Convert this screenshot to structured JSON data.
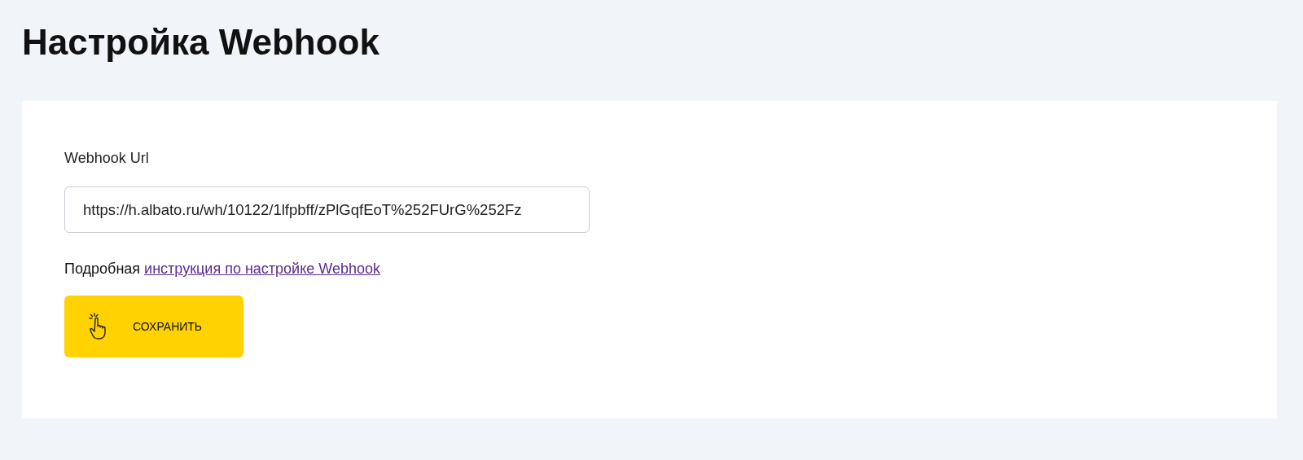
{
  "page": {
    "title": "Настройка Webhook"
  },
  "form": {
    "label": "Webhook Url",
    "value": "https://h.albato.ru/wh/10122/1lfpbff/zPlGqfEoT%252FUrG%252Fz",
    "help": {
      "text": "Подробная",
      "link": "инструкция по настройке Webhook"
    },
    "save_button": {
      "label": "СОХРАНИТЬ"
    }
  }
}
